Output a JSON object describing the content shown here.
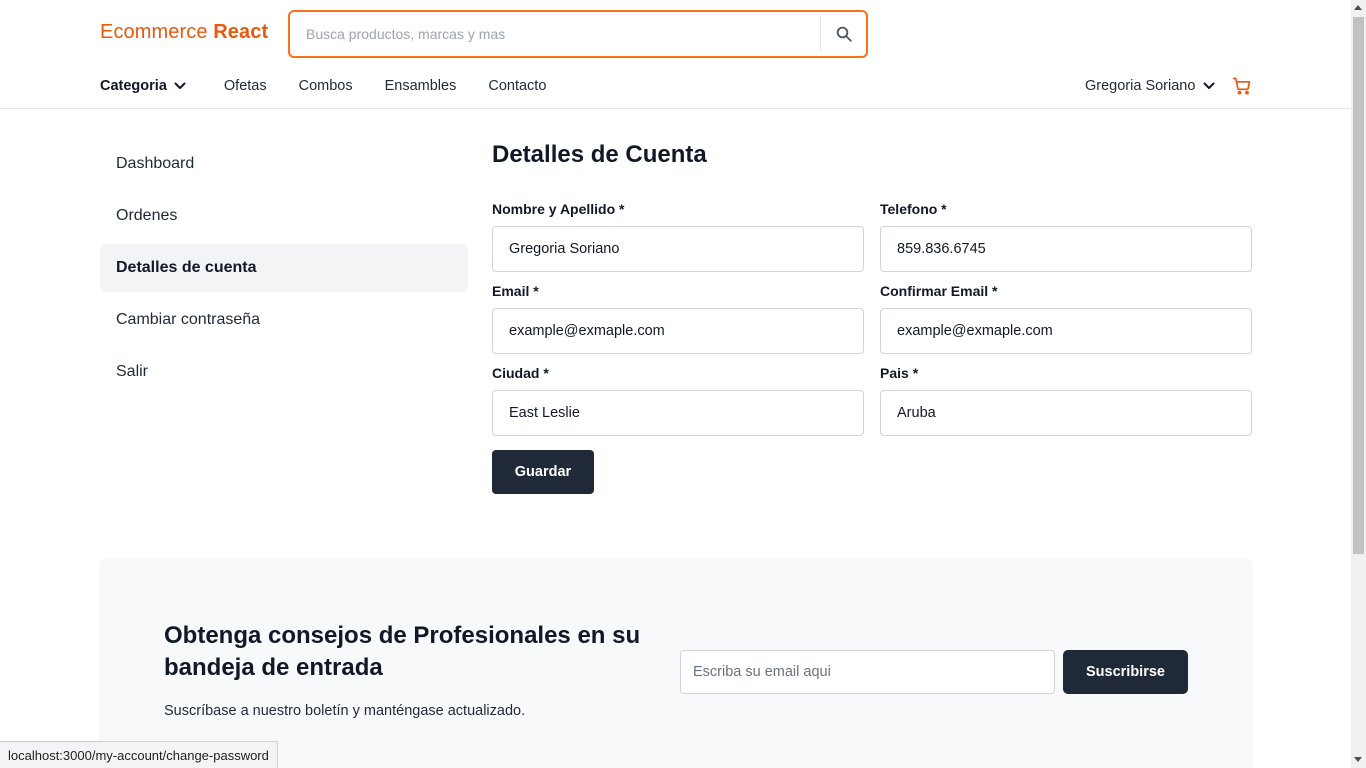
{
  "header": {
    "logo_regular": "Ecommerce",
    "logo_bold": "React",
    "search_placeholder": "Busca productos, marcas y mas",
    "search_icon": "search-icon",
    "nav": {
      "category_label": "Categoria",
      "links": [
        "Ofetas",
        "Combos",
        "Ensambles",
        "Contacto"
      ]
    },
    "user_name": "Gregoria Soriano",
    "cart_icon": "cart-icon",
    "accent_color": "#ea580c"
  },
  "sidebar": {
    "items": [
      {
        "label": "Dashboard",
        "active": false
      },
      {
        "label": "Ordenes",
        "active": false
      },
      {
        "label": "Detalles de cuenta",
        "active": true
      },
      {
        "label": "Cambiar contraseña",
        "active": false
      },
      {
        "label": "Salir",
        "active": false
      }
    ]
  },
  "form": {
    "title": "Detalles de Cuenta",
    "fields": {
      "name": {
        "label": "Nombre y Apellido *",
        "value": "Gregoria Soriano"
      },
      "phone": {
        "label": "Telefono *",
        "value": "859.836.6745"
      },
      "email": {
        "label": "Email *",
        "value": "example@exmaple.com"
      },
      "confirm_email": {
        "label": "Confirmar Email *",
        "value": "example@exmaple.com"
      },
      "city": {
        "label": "Ciudad *",
        "value": "East Leslie"
      },
      "country": {
        "label": "Pais *",
        "value": "Aruba"
      }
    },
    "save_label": "Guardar"
  },
  "newsletter": {
    "title": "Obtenga consejos de Profesionales en su bandeja de entrada",
    "subtitle": "Suscríbase a nuestro boletín y manténgase actualizado.",
    "email_placeholder": "Escriba su email aqui",
    "subscribe_label": "Suscribirse"
  },
  "statusbar": {
    "url": "localhost:3000/my-account/change-password"
  },
  "colors": {
    "accent": "#ea580c",
    "dark_button": "#1f2937",
    "active_sidebar_bg": "#f3f4f6"
  }
}
